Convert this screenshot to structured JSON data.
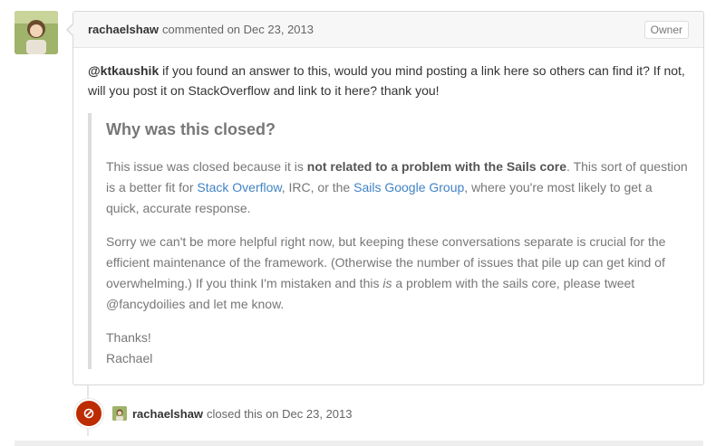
{
  "comment": {
    "author": "rachaelshaw",
    "action": "commented on Dec 23, 2013",
    "badge": "Owner",
    "intro": {
      "mention": "@ktkaushik",
      "text": " if you found an answer to this, would you mind posting a link here so others can find it? If not, will you post it on StackOverflow and link to it here? thank you!"
    },
    "quote": {
      "title": "Why was this closed?",
      "p1_a": "This issue was closed because it is ",
      "p1_strong": "not related to a problem with the Sails core",
      "p1_b": ". This sort of question is a better fit for ",
      "p1_link1": "Stack Overflow",
      "p1_c": ", IRC, or the ",
      "p1_link2": "Sails Google Group",
      "p1_d": ", where you're most likely to get a quick, accurate response.",
      "p2_a": "Sorry we can't be more helpful right now, but keeping these conversations separate is crucial for the efficient maintenance of the framework. (Otherwise the number of issues that pile up can get kind of overwhelming.) If you think I'm mistaken and this ",
      "p2_em": "is",
      "p2_b": " a problem with the sails core, please tweet @fancydoilies and let me know.",
      "thanks": "Thanks!",
      "signature": "Rachael"
    }
  },
  "event": {
    "author": "rachaelshaw",
    "text": "closed this on Dec 23, 2013"
  },
  "colors": {
    "link": "#4183c4",
    "closed": "#bd2c00"
  }
}
